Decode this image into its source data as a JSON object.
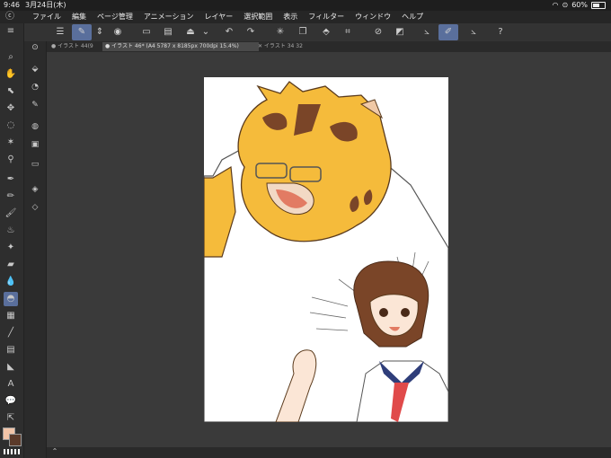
{
  "status": {
    "time": "9:46",
    "date": "3月24日(木)",
    "battery": "60%"
  },
  "menu": [
    "ファイル",
    "編集",
    "ページ管理",
    "アニメーション",
    "レイヤー",
    "選択範囲",
    "表示",
    "フィルター",
    "ウィンドウ",
    "ヘルプ"
  ],
  "tabs": [
    {
      "label": "● イラスト 44(9"
    },
    {
      "label": "● イラスト 46* (A4 5787 x 8185px 700dpi 15.4%)"
    },
    {
      "label": "✕ イラスト 34 32"
    }
  ],
  "icons": {
    "app_logo": "clip-studio-logo-icon",
    "wifi": "wifi-icon",
    "battery": "battery-icon"
  },
  "colors": {
    "main": "#f1c4a8",
    "sub": "#5b3a2a",
    "accent": "#5a6f9c"
  }
}
